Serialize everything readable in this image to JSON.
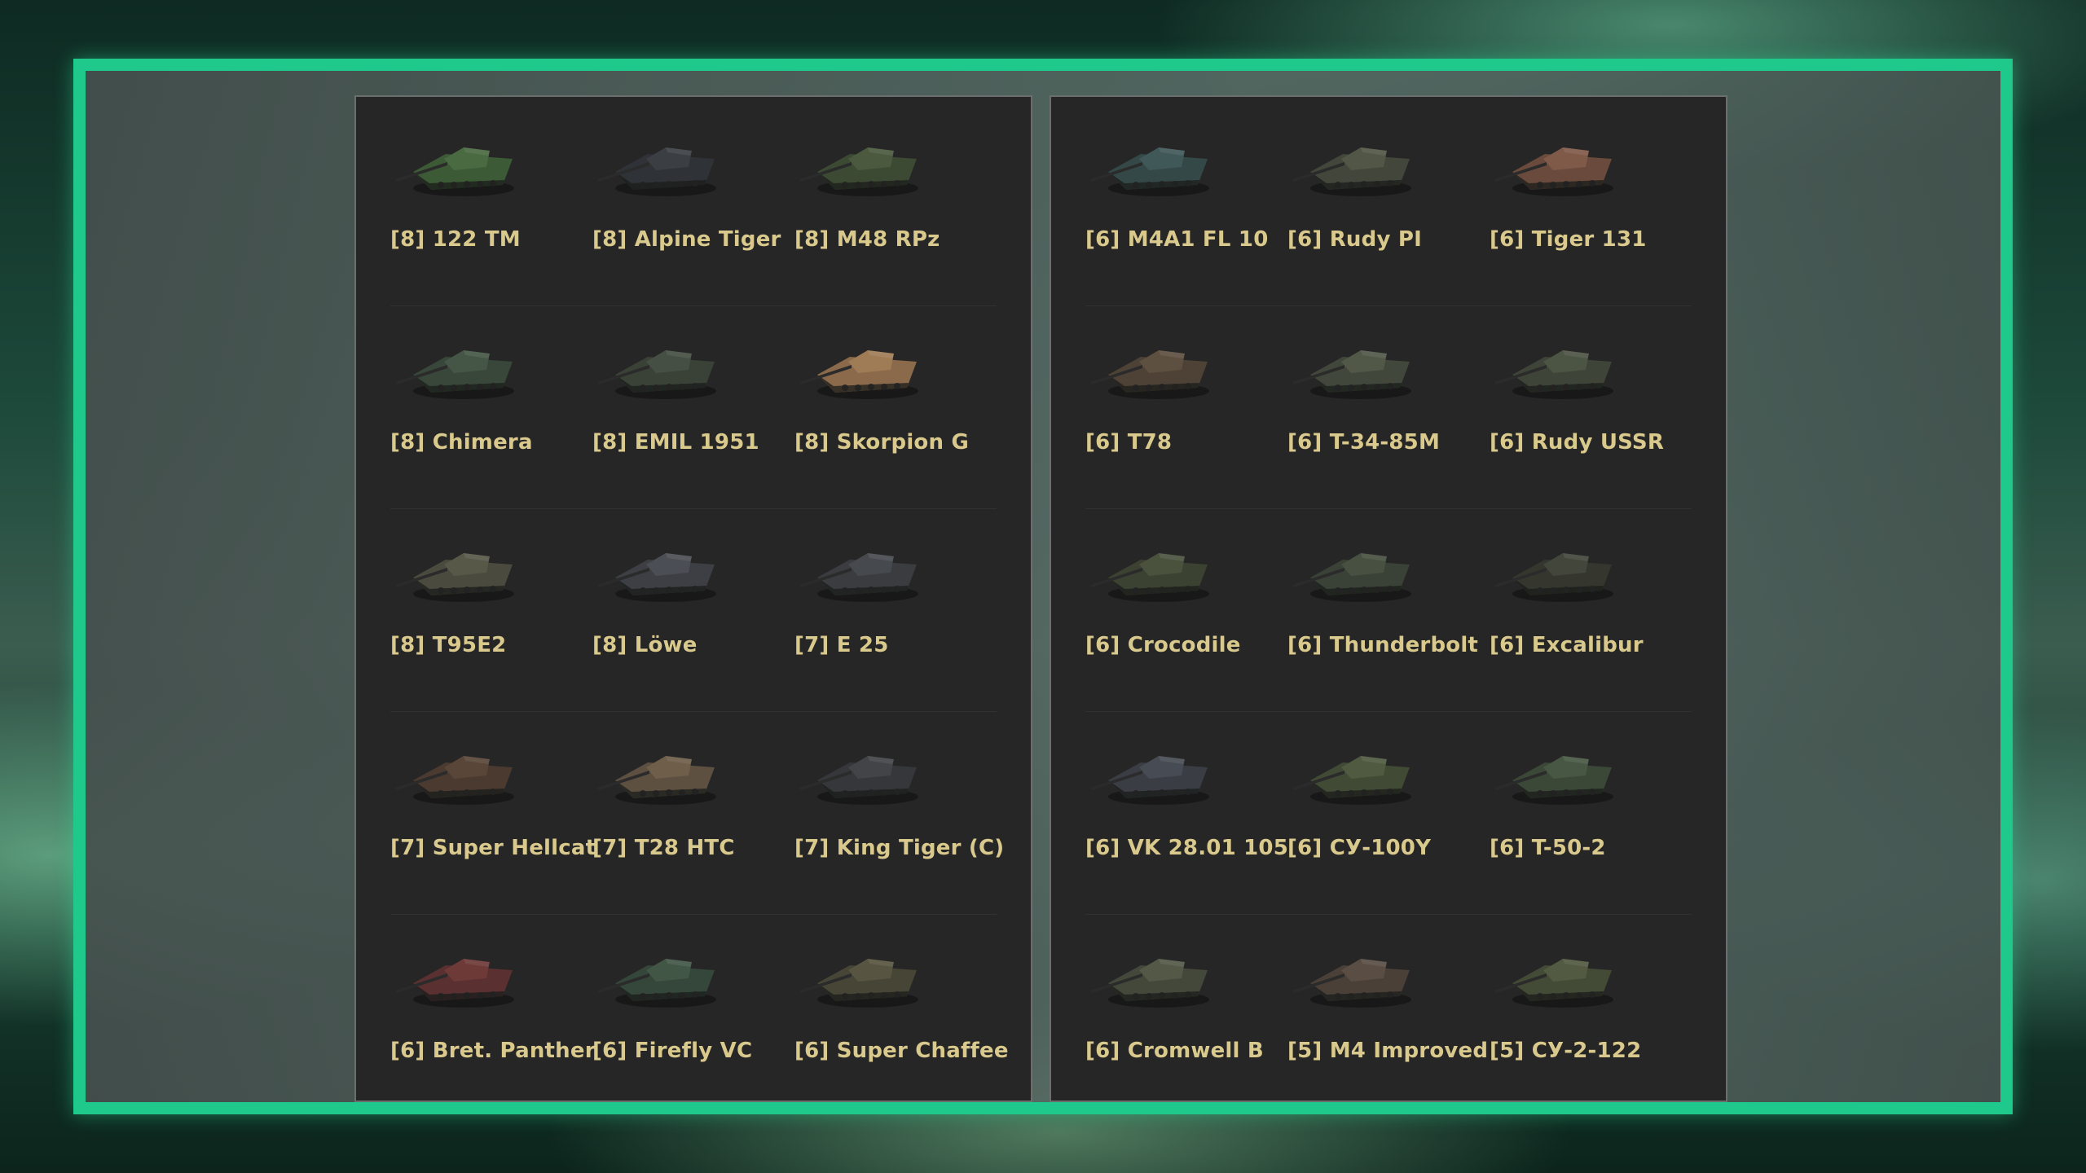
{
  "panels": [
    {
      "rows": [
        [
          {
            "label": "[8] 122 TM",
            "hull": "#3d5a36",
            "turret": "#4a6a42"
          },
          {
            "label": "[8] Alpine Tiger",
            "hull": "#2f3236",
            "turret": "#3b3f44"
          },
          {
            "label": "[8] M48 RPz",
            "hull": "#3c4a33",
            "turret": "#4b5a3f"
          }
        ],
        [
          {
            "label": "[8] Chimera",
            "hull": "#39473a",
            "turret": "#455646"
          },
          {
            "label": "[8] EMIL 1951",
            "hull": "#3a4238",
            "turret": "#464f43"
          },
          {
            "label": "[8] Skorpion G",
            "hull": "#8a6a4a",
            "turret": "#a07c56"
          }
        ],
        [
          {
            "label": "[8] T95E2",
            "hull": "#4a4a3e",
            "turret": "#585849"
          },
          {
            "label": "[8] Löwe",
            "hull": "#3d3f44",
            "turret": "#4b4e54"
          },
          {
            "label": "[7] E 25",
            "hull": "#3a3c40",
            "turret": "#46494e"
          }
        ],
        [
          {
            "label": "[7] Super Hellcat",
            "hull": "#4a3a30",
            "turret": "#5a4638"
          },
          {
            "label": "[7] T28 HTC",
            "hull": "#5e5040",
            "turret": "#6e5e4a"
          },
          {
            "label": "[7] King Tiger (C)",
            "hull": "#35373a",
            "turret": "#424448"
          }
        ],
        [
          {
            "label": "[6] Bret. Panther",
            "hull": "#5a3030",
            "turret": "#6d3a38"
          },
          {
            "label": "[6] Firefly VC",
            "hull": "#35463a",
            "turret": "#425646"
          },
          {
            "label": "[6] Super Chaffee",
            "hull": "#474536",
            "turret": "#575441"
          }
        ]
      ]
    },
    {
      "rows": [
        [
          {
            "label": "[6] M4A1 FL 10",
            "hull": "#354848",
            "turret": "#415858"
          },
          {
            "label": "[6] Rudy PI",
            "hull": "#43463a",
            "turret": "#525646"
          },
          {
            "label": "[6] Tiger 131",
            "hull": "#6a4a3c",
            "turret": "#805a48"
          }
        ],
        [
          {
            "label": "[6] T78",
            "hull": "#4e4236",
            "turret": "#5e5040"
          },
          {
            "label": "[6] T-34-85M",
            "hull": "#42473c",
            "turret": "#525848"
          },
          {
            "label": "[6] Rudy USSR",
            "hull": "#3e4538",
            "turret": "#4c5444"
          }
        ],
        [
          {
            "label": "[6] Crocodile",
            "hull": "#3c4232",
            "turret": "#4a523e"
          },
          {
            "label": "[6] Thunderbolt",
            "hull": "#3a4136",
            "turret": "#475041"
          },
          {
            "label": "[6] Excalibur",
            "hull": "#35372f",
            "turret": "#43463b"
          }
        ],
        [
          {
            "label": "[6] VK 28.01 105",
            "hull": "#3a3d44",
            "turret": "#474b53"
          },
          {
            "label": "[6] СУ-100Y",
            "hull": "#414a34",
            "turret": "#505a40"
          },
          {
            "label": "[6] T-50-2",
            "hull": "#3b4737",
            "turret": "#485744"
          }
        ],
        [
          {
            "label": "[6] Cromwell B",
            "hull": "#44483a",
            "turret": "#535847"
          },
          {
            "label": "[5] M4 Improved",
            "hull": "#4a4038",
            "turret": "#5a4e44"
          },
          {
            "label": "[5] СУ-2-122",
            "hull": "#434a36",
            "turret": "#525a42"
          }
        ]
      ]
    }
  ]
}
